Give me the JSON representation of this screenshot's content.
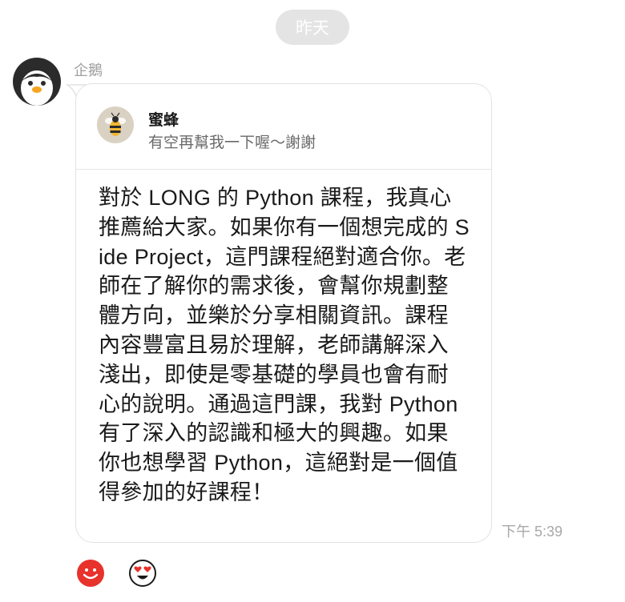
{
  "date_divider": {
    "label": "昨天"
  },
  "message": {
    "sender_name": "企鵝",
    "avatar_icon": "penguin-icon",
    "reply_quote": {
      "name": "蜜蜂",
      "text": "有空再幫我一下喔～謝謝",
      "avatar_icon": "bee-icon"
    },
    "body": "對於 LONG 的 Python 課程，我真心推薦給大家。如果你有一個想完成的 Side Project，這門課程絕對適合你。老師在了解你的需求後，會幫你規劃整體方向，並樂於分享相關資訊。課程內容豐富且易於理解，老師講解深入淺出，即使是零基礎的學員也會有耐心的說明。通過這門課，我對 Python 有了深入的認識和極大的興趣。如果你也想學習 Python，這絕對是一個值得參加的好課程！",
    "timestamp": "下午 5:39"
  },
  "reactions": [
    {
      "icon": "smile-emoji-icon",
      "color": "#e8322c"
    },
    {
      "icon": "heart-eyes-emoji-icon",
      "color": "#1a1a1a"
    }
  ],
  "colors": {
    "date_pill_bg": "#e4e4e4",
    "bubble_border": "#e2e2e2",
    "reaction_red": "#e8322c"
  }
}
